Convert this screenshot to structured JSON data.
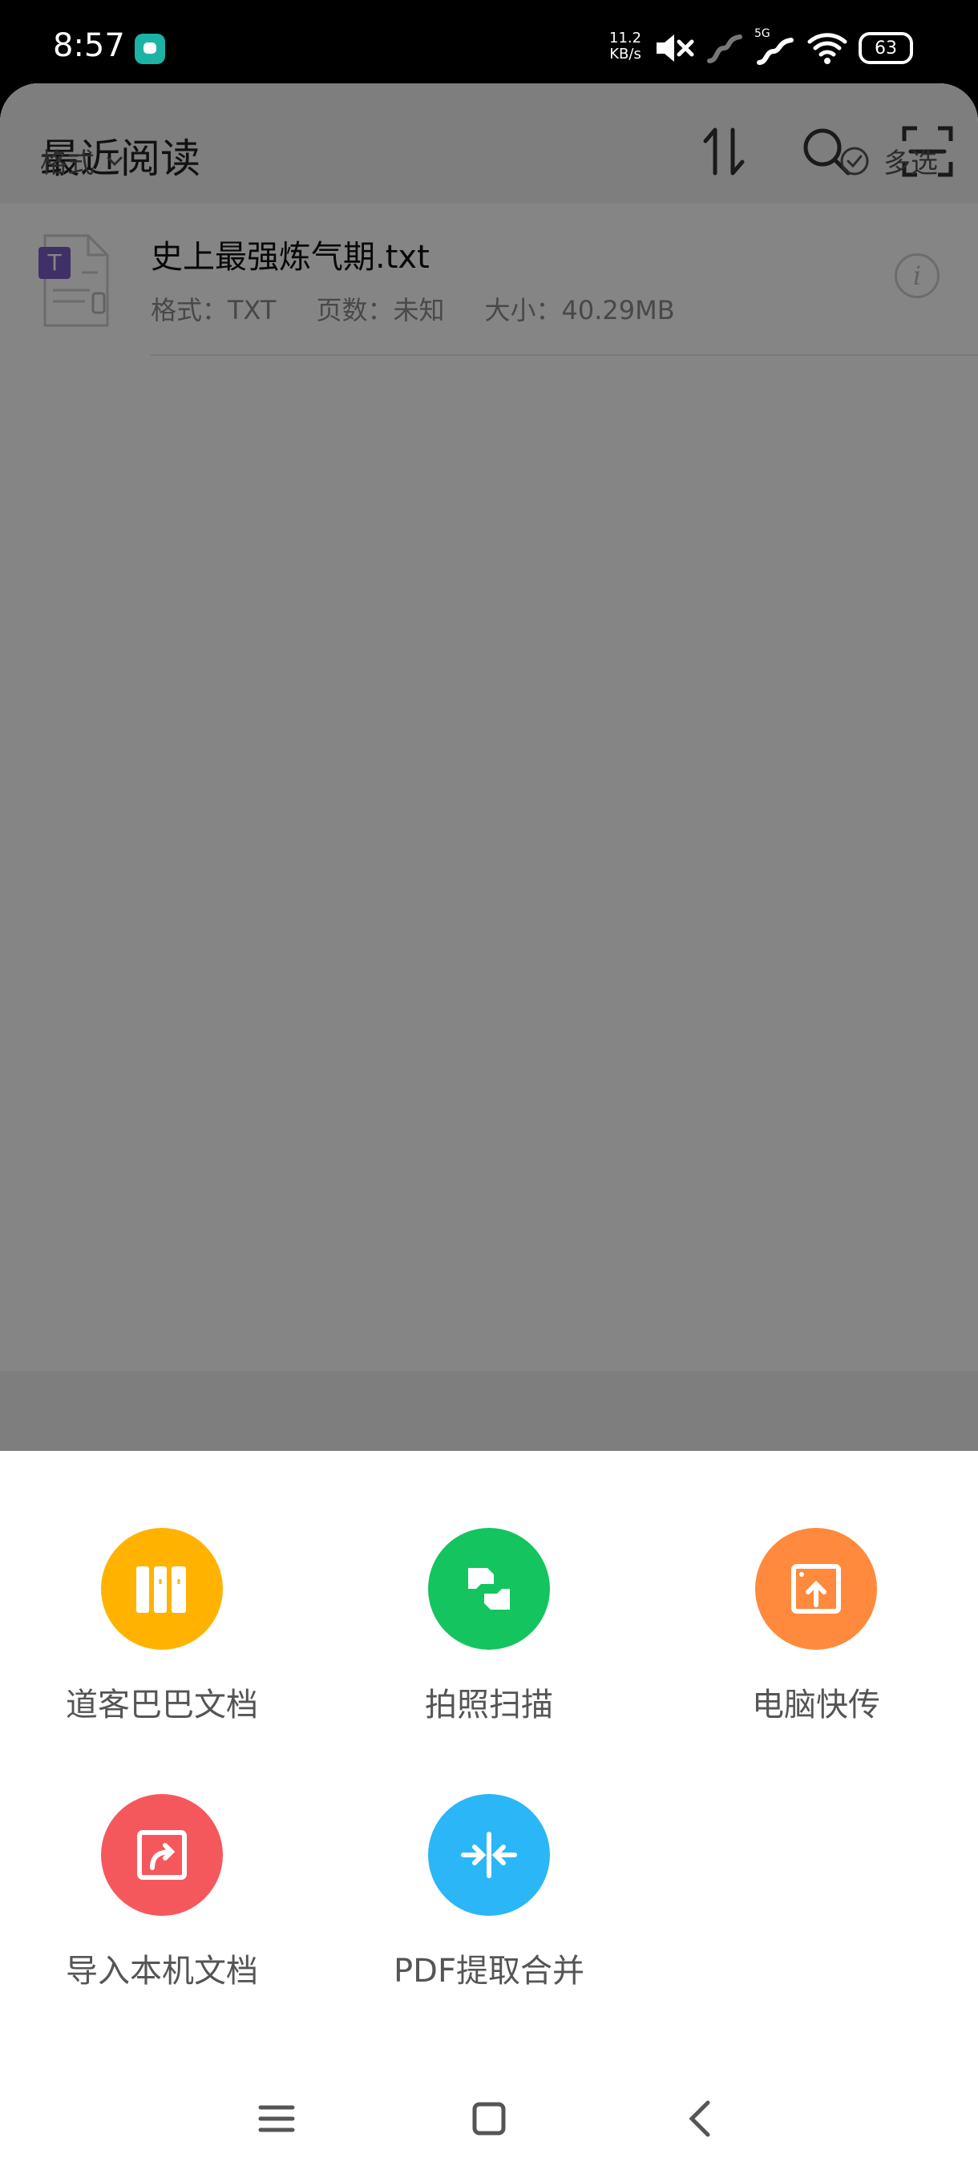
{
  "status_bar": {
    "time": "8:57",
    "net_speed_value": "11.2",
    "net_speed_unit": "KB/s",
    "network_label": "5G",
    "battery": "63"
  },
  "header": {
    "title": "最近阅读"
  },
  "filter_bar": {
    "format_label": "格式",
    "multi_select_label": "多选"
  },
  "files": [
    {
      "name": "史上最强炼气期.txt",
      "format": "格式：TXT",
      "pages": "页数：未知",
      "size": "大小：40.29MB",
      "icon_letter": "T"
    }
  ],
  "sheet": {
    "items": [
      {
        "label": "道客巴巴文档",
        "icon": "books-icon",
        "color": "#FFB300"
      },
      {
        "label": "拍照扫描",
        "icon": "scan-icon",
        "color": "#14C45F"
      },
      {
        "label": "电脑快传",
        "icon": "upload-icon",
        "color": "#FF8A3D"
      },
      {
        "label": "导入本机文档",
        "icon": "import-icon",
        "color": "#F5585C"
      },
      {
        "label": "PDF提取合并",
        "icon": "merge-icon",
        "color": "#2BB6F7"
      }
    ]
  },
  "colors": {
    "overlay": "rgba(0,0,0,0.48)",
    "file_badge": "#7A5CC8"
  }
}
